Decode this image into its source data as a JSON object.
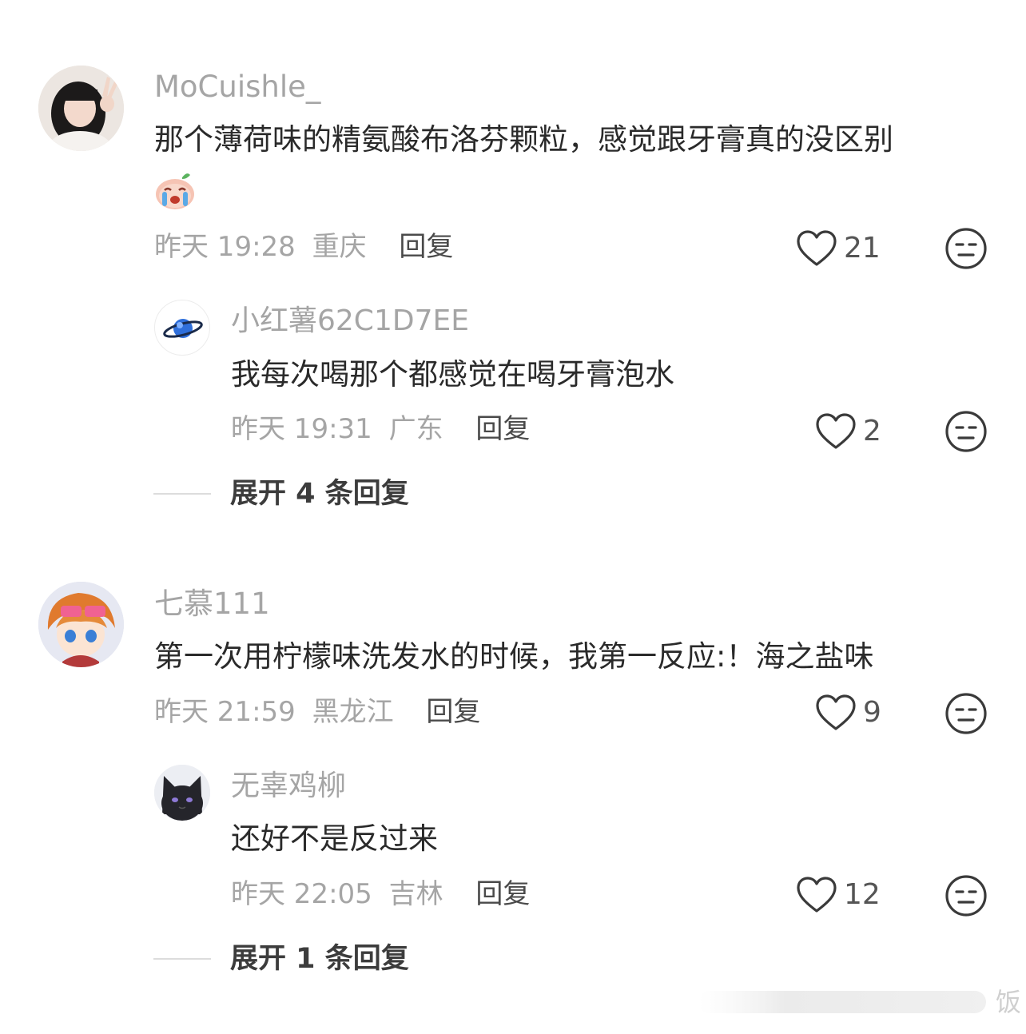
{
  "comments": [
    {
      "username": "MoCuishle_",
      "text_line1": "那个薄荷味的精氨酸布洛芬颗粒，感觉跟牙膏真的没区别",
      "emoji": "crying-laughing-peach-emoji",
      "time": "昨天 19:28",
      "location": "重庆",
      "reply_label": "回复",
      "likes": "21",
      "replies": [
        {
          "username": "小红薯62C1D7EE",
          "text": "我每次喝那个都感觉在喝牙膏泡水",
          "time": "昨天 19:31",
          "location": "广东",
          "reply_label": "回复",
          "likes": "2"
        }
      ],
      "expand_label": "展开 4 条回复"
    },
    {
      "username": "七慕111",
      "text_line1": "第一次用柠檬味洗发水的时候，我第一反应:！海之盐味",
      "time": "昨天 21:59",
      "location": "黑龙江",
      "reply_label": "回复",
      "likes": "9",
      "replies": [
        {
          "username": "无辜鸡柳",
          "text": "还好不是反过来",
          "time": "昨天 22:05",
          "location": "吉林",
          "reply_label": "回复",
          "likes": "12"
        }
      ],
      "expand_label": "展开 1 条回复"
    }
  ],
  "watermark": "饭"
}
